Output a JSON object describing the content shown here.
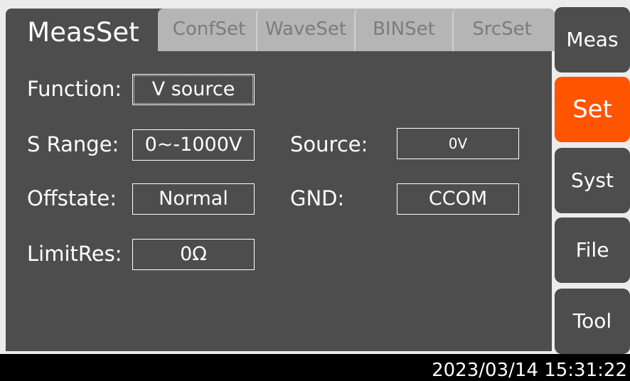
{
  "tabs": {
    "active": "MeasSet",
    "others": [
      "ConfSet",
      "WaveSet",
      "BINSet",
      "SrcSet"
    ]
  },
  "form": {
    "function_label": "Function:",
    "function_value": "V source",
    "srange_label": "S Range:",
    "srange_value": "0~-1000V",
    "source_label": "Source:",
    "source_value": "0V",
    "offstate_label": "Offstate:",
    "offstate_value": "Normal",
    "gnd_label": "GND:",
    "gnd_value": "CCOM",
    "limitres_label": "LimitRes:",
    "limitres_value": "0Ω"
  },
  "sidebar": {
    "items": [
      {
        "label": "Meas"
      },
      {
        "label": "Set",
        "active": true
      },
      {
        "label": "Syst"
      },
      {
        "label": "File"
      },
      {
        "label": "Tool"
      }
    ]
  },
  "status": {
    "datetime": "2023/03/14 15:31:22"
  },
  "colors": {
    "accent": "#ff5500",
    "panel": "#4d4d4d",
    "tab_inactive": "#b5b5b5",
    "tab_text": "#7c7c7c",
    "background": "#ececec"
  }
}
